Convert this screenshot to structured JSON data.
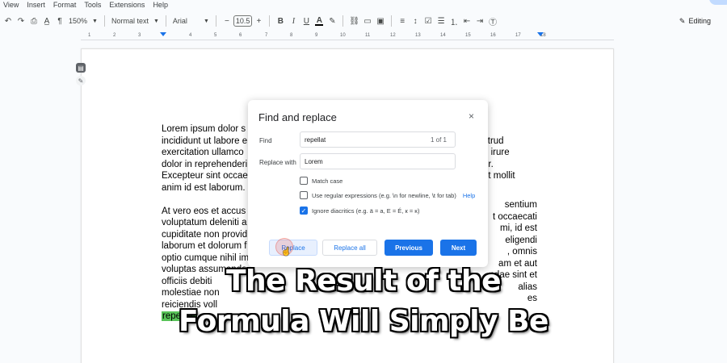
{
  "menu": [
    "View",
    "Insert",
    "Format",
    "Tools",
    "Extensions",
    "Help"
  ],
  "toolbar": {
    "zoom": "150%",
    "style": "Normal text",
    "font": "Arial",
    "font_size": "10.5",
    "minus": "−",
    "plus": "+",
    "bold": "B",
    "italic": "I",
    "underline": "U",
    "text_color": "A",
    "editing": "Editing"
  },
  "ruler": [
    "1",
    "2",
    "3",
    "4",
    "5",
    "6",
    "7",
    "8",
    "9",
    "10",
    "11",
    "12",
    "13",
    "14",
    "15",
    "16",
    "17",
    "18"
  ],
  "document": {
    "paragraph1": "Lorem ipsum dolor s\nincididunt ut labore e\nexercitation ullamco\ndolor in reprehenderi\nExcepteur sint occae\nanim id est laborum.",
    "paragraph1_right": "r\nstrud\ne irure\nur.\nnt mollit",
    "paragraph2": "At vero eos et accus\nvoluptatum deleniti a\ncupiditate non provid\nlaborum et dolorum f\noptio cumque nihil im\nvoluptas assumenda\nofficiis debiti\nmolestiae non\nreiciendis voll",
    "paragraph2_right": "sentium\nt occaecati\nmi, id est\neligendi\n, omnis\nam et aut\nndae sint et\nalias\nes",
    "last_line_tail": "is saepe eveniet ut et voluptates repudiandae sint et",
    "highlight_word": "repellat."
  },
  "dialog": {
    "title": "Find and replace",
    "close": "×",
    "find_label": "Find",
    "find_value": "repellat",
    "match_count": "1 of 1",
    "replace_label": "Replace with",
    "replace_value": "Lorem",
    "match_case": "Match case",
    "regex": "Use regular expressions (e.g. \\n for newline, \\t for tab)",
    "help": "Help",
    "diacritics": "Ignore diacritics (e.g. ä = a, E = É, к = κ)",
    "buttons": {
      "replace": "Replace",
      "replace_all": "Replace all",
      "previous": "Previous",
      "next": "Next"
    }
  },
  "caption": {
    "line1": "The Result of the",
    "line2": "Formula Will Simply Be"
  },
  "colors": {
    "accent": "#1a73e8",
    "highlight": "#58c458"
  }
}
